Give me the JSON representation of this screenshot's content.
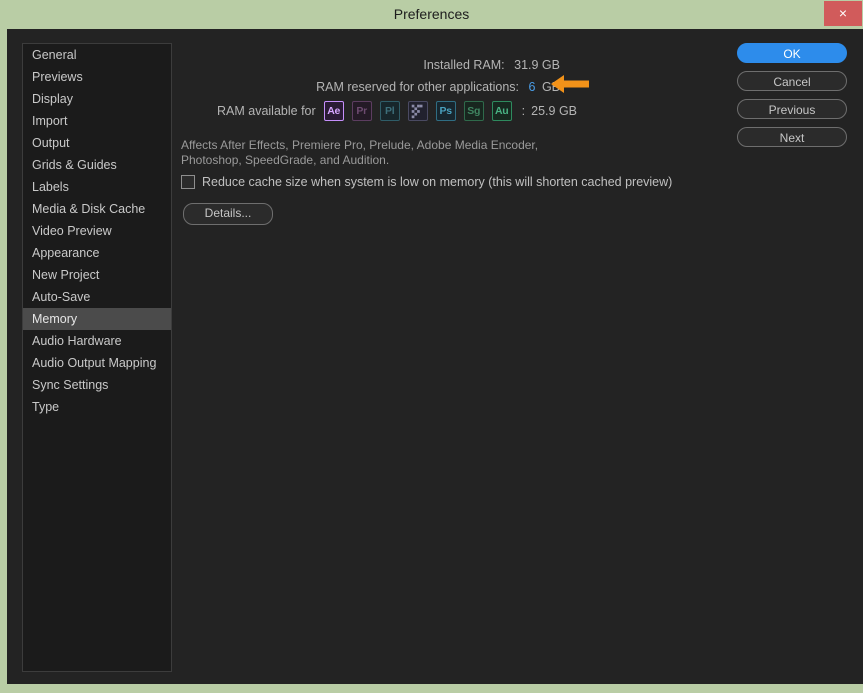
{
  "window": {
    "title": "Preferences",
    "close_label": "×"
  },
  "sidebar": {
    "items": [
      {
        "label": "General",
        "selected": false
      },
      {
        "label": "Previews",
        "selected": false
      },
      {
        "label": "Display",
        "selected": false
      },
      {
        "label": "Import",
        "selected": false
      },
      {
        "label": "Output",
        "selected": false
      },
      {
        "label": "Grids & Guides",
        "selected": false
      },
      {
        "label": "Labels",
        "selected": false
      },
      {
        "label": "Media & Disk Cache",
        "selected": false
      },
      {
        "label": "Video Preview",
        "selected": false
      },
      {
        "label": "Appearance",
        "selected": false
      },
      {
        "label": "New Project",
        "selected": false
      },
      {
        "label": "Auto-Save",
        "selected": false
      },
      {
        "label": "Memory",
        "selected": true
      },
      {
        "label": "Audio Hardware",
        "selected": false
      },
      {
        "label": "Audio Output Mapping",
        "selected": false
      },
      {
        "label": "Sync Settings",
        "selected": false
      },
      {
        "label": "Type",
        "selected": false
      }
    ]
  },
  "memory": {
    "installed_ram_label": "Installed RAM:",
    "installed_ram_value": "31.9 GB",
    "reserved_ram_label": "RAM reserved for other applications:",
    "reserved_ram_value": "6",
    "reserved_ram_unit": "GB",
    "available_label": "RAM available for",
    "available_separator": ":",
    "available_value": "25.9 GB",
    "apps": [
      {
        "code": "Ae",
        "name": "after-effects",
        "style": "ae",
        "active": true
      },
      {
        "code": "Pr",
        "name": "premiere-pro",
        "style": "pr",
        "active": false
      },
      {
        "code": "Pl",
        "name": "prelude",
        "style": "pl",
        "active": false
      },
      {
        "code": "Me",
        "name": "adobe-media-encoder",
        "style": "me",
        "active": false
      },
      {
        "code": "Ps",
        "name": "photoshop",
        "style": "ps",
        "active": false
      },
      {
        "code": "Sg",
        "name": "speedgrade",
        "style": "sg",
        "active": false
      },
      {
        "code": "Au",
        "name": "audition",
        "style": "au",
        "active": false
      }
    ],
    "affects_text": "Affects After Effects, Premiere Pro, Prelude, Adobe Media Encoder, Photoshop, SpeedGrade, and Audition.",
    "reduce_cache_label": "Reduce cache size when system is low on memory (this will shorten cached preview)",
    "reduce_cache_checked": false,
    "details_label": "Details..."
  },
  "buttons": {
    "ok": "OK",
    "cancel": "Cancel",
    "previous": "Previous",
    "next": "Next"
  },
  "annotation": {
    "arrow_color": "#f29219",
    "arrow_direction": "left"
  },
  "colors": {
    "accent": "#2d8ceb",
    "editable_value": "#4a9ee8",
    "window_chrome": "#b9cda5",
    "dialog_bg": "#232323",
    "sidebar_bg": "#1b1b1b",
    "selection": "#4b4b4b",
    "close_button": "#d15b5b"
  }
}
